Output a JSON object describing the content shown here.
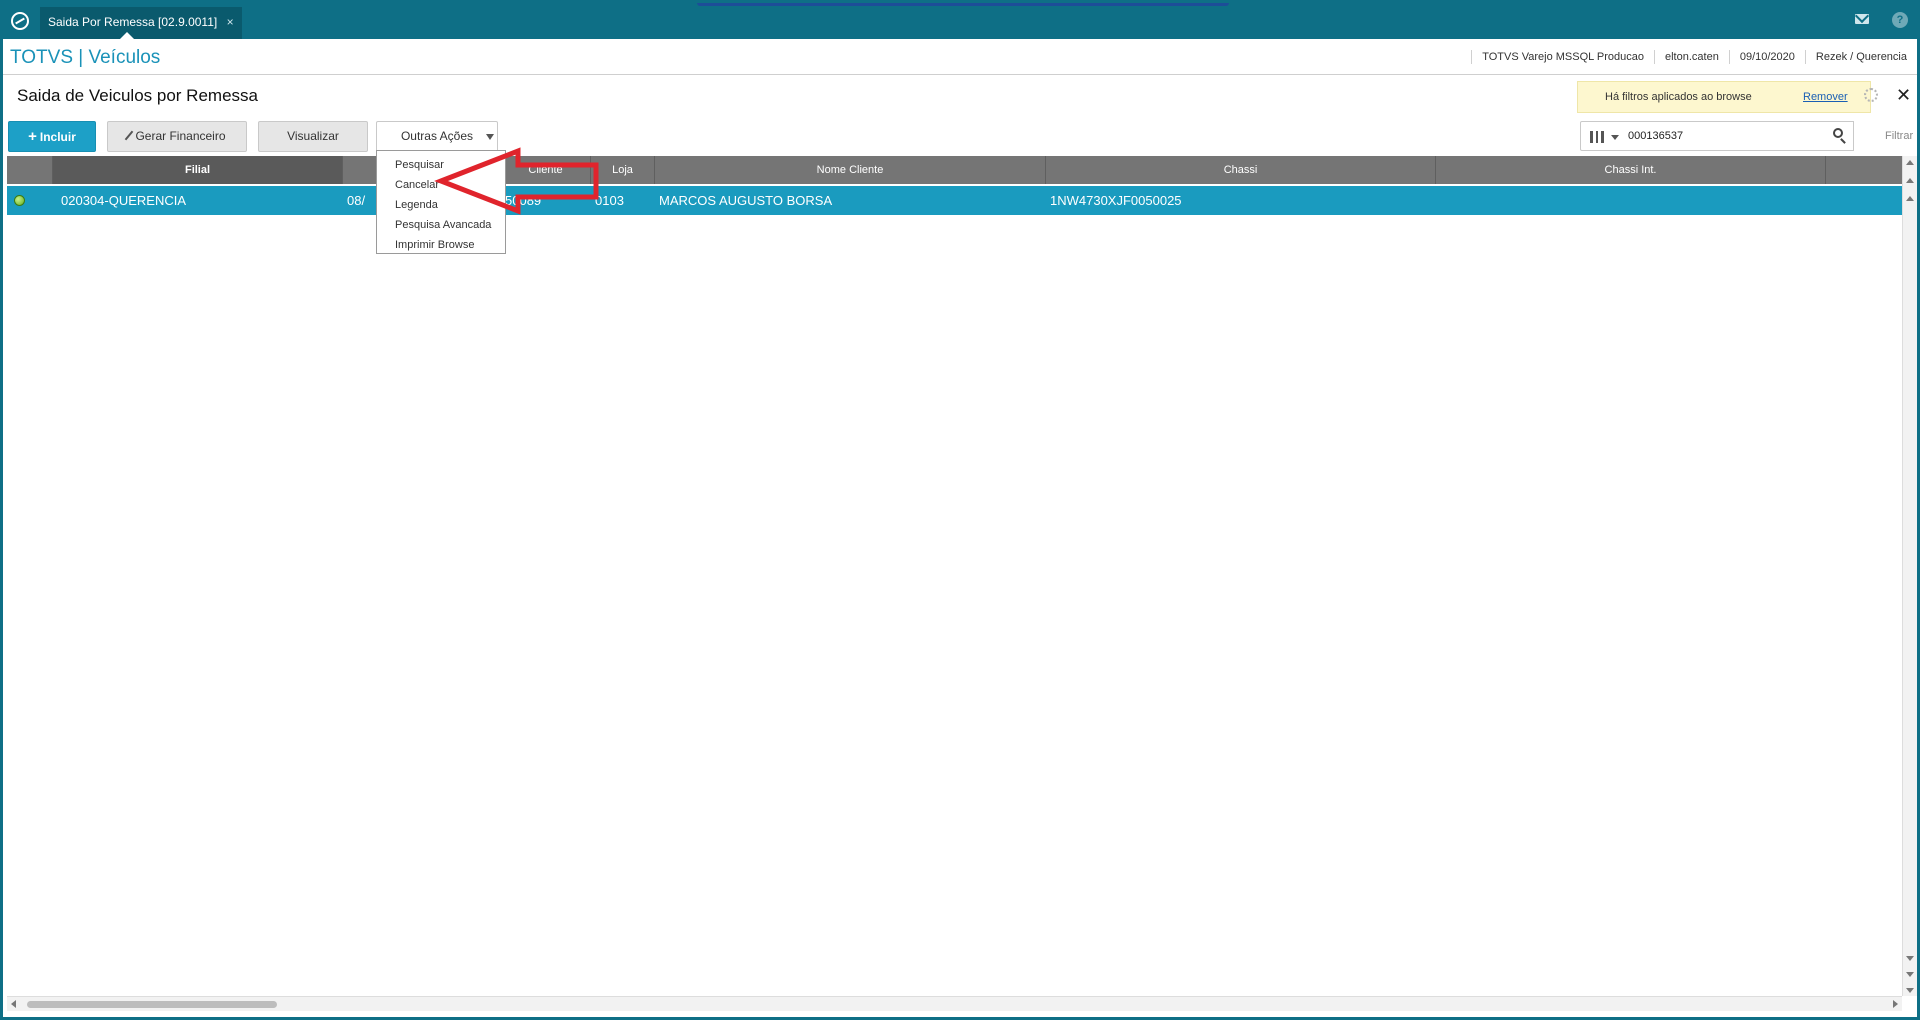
{
  "window": {
    "tab_title": "Saida Por Remessa [02.9.0011]",
    "tab_close": "×"
  },
  "header": {
    "brand": "TOTVS | Veículos",
    "environment": "TOTVS Varejo MSSQL Producao",
    "user": "elton.caten",
    "date": "09/10/2020",
    "company": "Rezek / Querencia"
  },
  "page": {
    "title": "Saida de Veiculos por Remessa",
    "filter_notice": "Há filtros aplicados ao browse",
    "filter_remove": "Remover",
    "close": "✕"
  },
  "toolbar": {
    "incluir": "Incluir",
    "gerar_financeiro": "Gerar Financeiro",
    "visualizar": "Visualizar",
    "outras_acoes": "Outras Ações"
  },
  "menu": {
    "items": [
      "Pesquisar",
      "Cancelar",
      "Legenda",
      "Pesquisa Avancada",
      "Imprimir Browse"
    ]
  },
  "search": {
    "value": "000136537",
    "filter_label": "Filtrar"
  },
  "grid": {
    "columns": [
      "Filial",
      "",
      "Cliente",
      "Loja",
      "Nome Cliente",
      "Chassi",
      "Chassi Int."
    ],
    "rows": [
      {
        "status": "green",
        "filial": "020304-QUERENCIA",
        "data": "08/",
        "cliente": "50089",
        "loja": "0103",
        "nome_cliente": "MARCOS AUGUSTO BORSA",
        "chassi": "1NW4730XJF0050025",
        "chassi_int": ""
      }
    ]
  },
  "colors": {
    "topbar": "#0e6f86",
    "accent": "#1da0c7",
    "selected_row": "#1a9bbf",
    "annotation": "#e0242c"
  }
}
